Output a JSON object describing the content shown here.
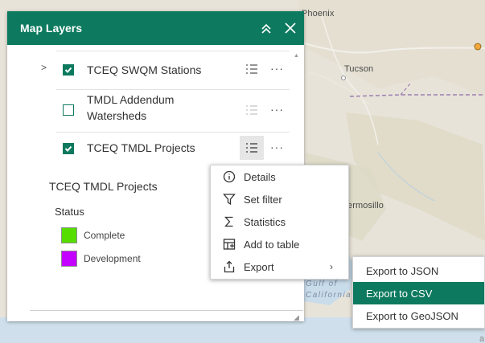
{
  "map": {
    "labels": {
      "phoenix": "Phoenix",
      "tucson": "Tucson",
      "hermosillo": "Hermosillo",
      "gulf": "Gulf of",
      "california": "California",
      "edge_text": "a"
    }
  },
  "panel": {
    "title": "Map Layers",
    "layers": [
      {
        "title": "TCEQ SWQM Stations",
        "checked": true,
        "expandable": true
      },
      {
        "title": "TMDL Addendum Watersheds",
        "checked": false,
        "expandable": false
      },
      {
        "title": "TCEQ TMDL Projects",
        "checked": true,
        "expandable": false
      }
    ],
    "legend": {
      "layer_title": "TCEQ TMDL Projects",
      "field": "Status",
      "items": [
        {
          "label": "Complete",
          "color": "#55dd00"
        },
        {
          "label": "Development",
          "color": "#c400ff"
        }
      ]
    }
  },
  "context_menu": {
    "items": [
      {
        "label": "Details",
        "icon": "info-icon"
      },
      {
        "label": "Set filter",
        "icon": "filter-icon"
      },
      {
        "label": "Statistics",
        "icon": "sigma-icon"
      },
      {
        "label": "Add to table",
        "icon": "add-table-icon"
      },
      {
        "label": "Export",
        "icon": "export-icon",
        "has_submenu": true
      }
    ]
  },
  "export_submenu": {
    "items": [
      {
        "label": "Export to JSON",
        "highlighted": false
      },
      {
        "label": "Export to CSV",
        "highlighted": true
      },
      {
        "label": "Export to GeoJSON",
        "highlighted": false
      }
    ]
  },
  "colors": {
    "accent": "#0d7a5f",
    "map_base": "#e7e2d8",
    "border": "#9b7fb0"
  }
}
